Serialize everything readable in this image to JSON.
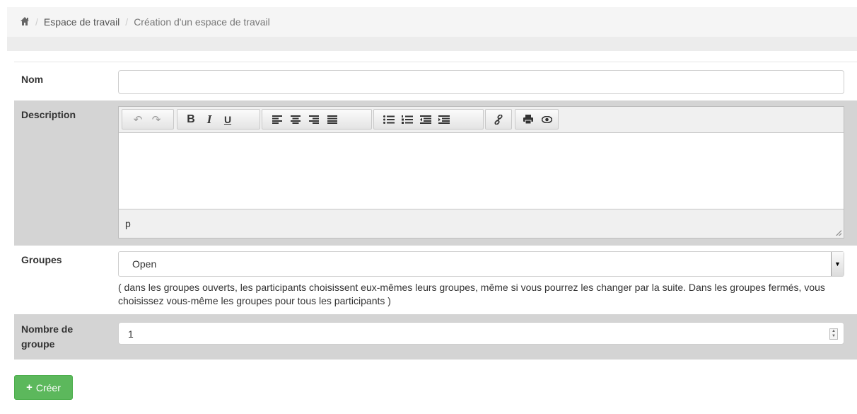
{
  "breadcrumb": {
    "home_icon": "home-icon",
    "items": [
      "Espace de travail",
      "Création d'un espace de travail"
    ]
  },
  "form": {
    "nom": {
      "label": "Nom",
      "value": ""
    },
    "description": {
      "label": "Description",
      "toolbar": [
        [
          "undo-icon",
          "redo-icon"
        ],
        [
          "bold-icon",
          "italic-icon",
          "underline-icon"
        ],
        [
          "align-left-icon",
          "align-center-icon",
          "align-right-icon",
          "align-justify-icon"
        ],
        [
          "bullet-list-icon",
          "numbered-list-icon",
          "outdent-icon",
          "indent-icon"
        ],
        [
          "link-icon"
        ],
        [
          "print-icon",
          "preview-icon"
        ]
      ],
      "path": "p"
    },
    "groupes": {
      "label": "Groupes",
      "selected": "Open",
      "hint": "( dans les groupes ouverts, les participants choisissent eux-mêmes leurs groupes, même si vous pourrez les changer par la suite. Dans les groupes fermés, vous choisissez vous-même les groupes pour tous les participants )"
    },
    "nombre": {
      "label": "Nombre de groupe",
      "value": "1"
    }
  },
  "actions": {
    "create_label": "Créer",
    "create_icon": "plus-icon"
  },
  "colors": {
    "success": "#5cb85c",
    "label_bg": "#d4d4d4",
    "breadcrumb_bg": "#f5f5f5"
  }
}
